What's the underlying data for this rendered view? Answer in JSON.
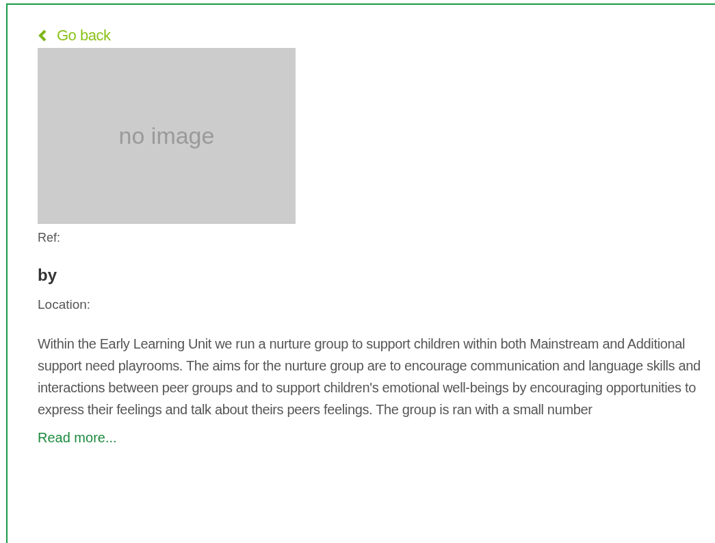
{
  "back_link": {
    "label": "Go back"
  },
  "image": {
    "kind": "picture",
    "label": "no image"
  },
  "ref": {
    "label": "Ref:"
  },
  "author": {
    "label": "by"
  },
  "location": {
    "label": "Location:"
  },
  "description": "Within the Early Learning Unit we run a nurture group to support children within both Mainstream and Additional support need playrooms. The aims for the nurture group are to encourage communication and language skills and interactions between peer groups and to support children's emotional well-beings by encouraging opportunities to express their feelings and talk about theirs peers feelings. The group is ran with a small number",
  "read_more": {
    "label": "Read more..."
  }
}
